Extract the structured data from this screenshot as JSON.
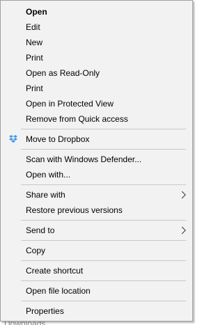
{
  "menu": {
    "group1": [
      {
        "label": "Open",
        "bold": true
      },
      {
        "label": "Edit"
      },
      {
        "label": "New"
      },
      {
        "label": "Print"
      },
      {
        "label": "Open as Read-Only"
      },
      {
        "label": "Print"
      },
      {
        "label": "Open in Protected View"
      },
      {
        "label": "Remove from Quick access"
      }
    ],
    "dropbox": {
      "label": "Move to Dropbox",
      "icon": "dropbox-icon",
      "icon_color": "#3d9ae8"
    },
    "group3": [
      {
        "label": "Scan with Windows Defender..."
      },
      {
        "label": "Open with..."
      }
    ],
    "group4": [
      {
        "label": "Share with",
        "submenu": true
      },
      {
        "label": "Restore previous versions"
      }
    ],
    "send_to": {
      "label": "Send to",
      "submenu": true
    },
    "copy": {
      "label": "Copy"
    },
    "create_shortcut": {
      "label": "Create shortcut"
    },
    "open_location": {
      "label": "Open file location"
    },
    "properties": {
      "label": "Properties"
    }
  },
  "background": {
    "partial_text": "Downloads"
  }
}
